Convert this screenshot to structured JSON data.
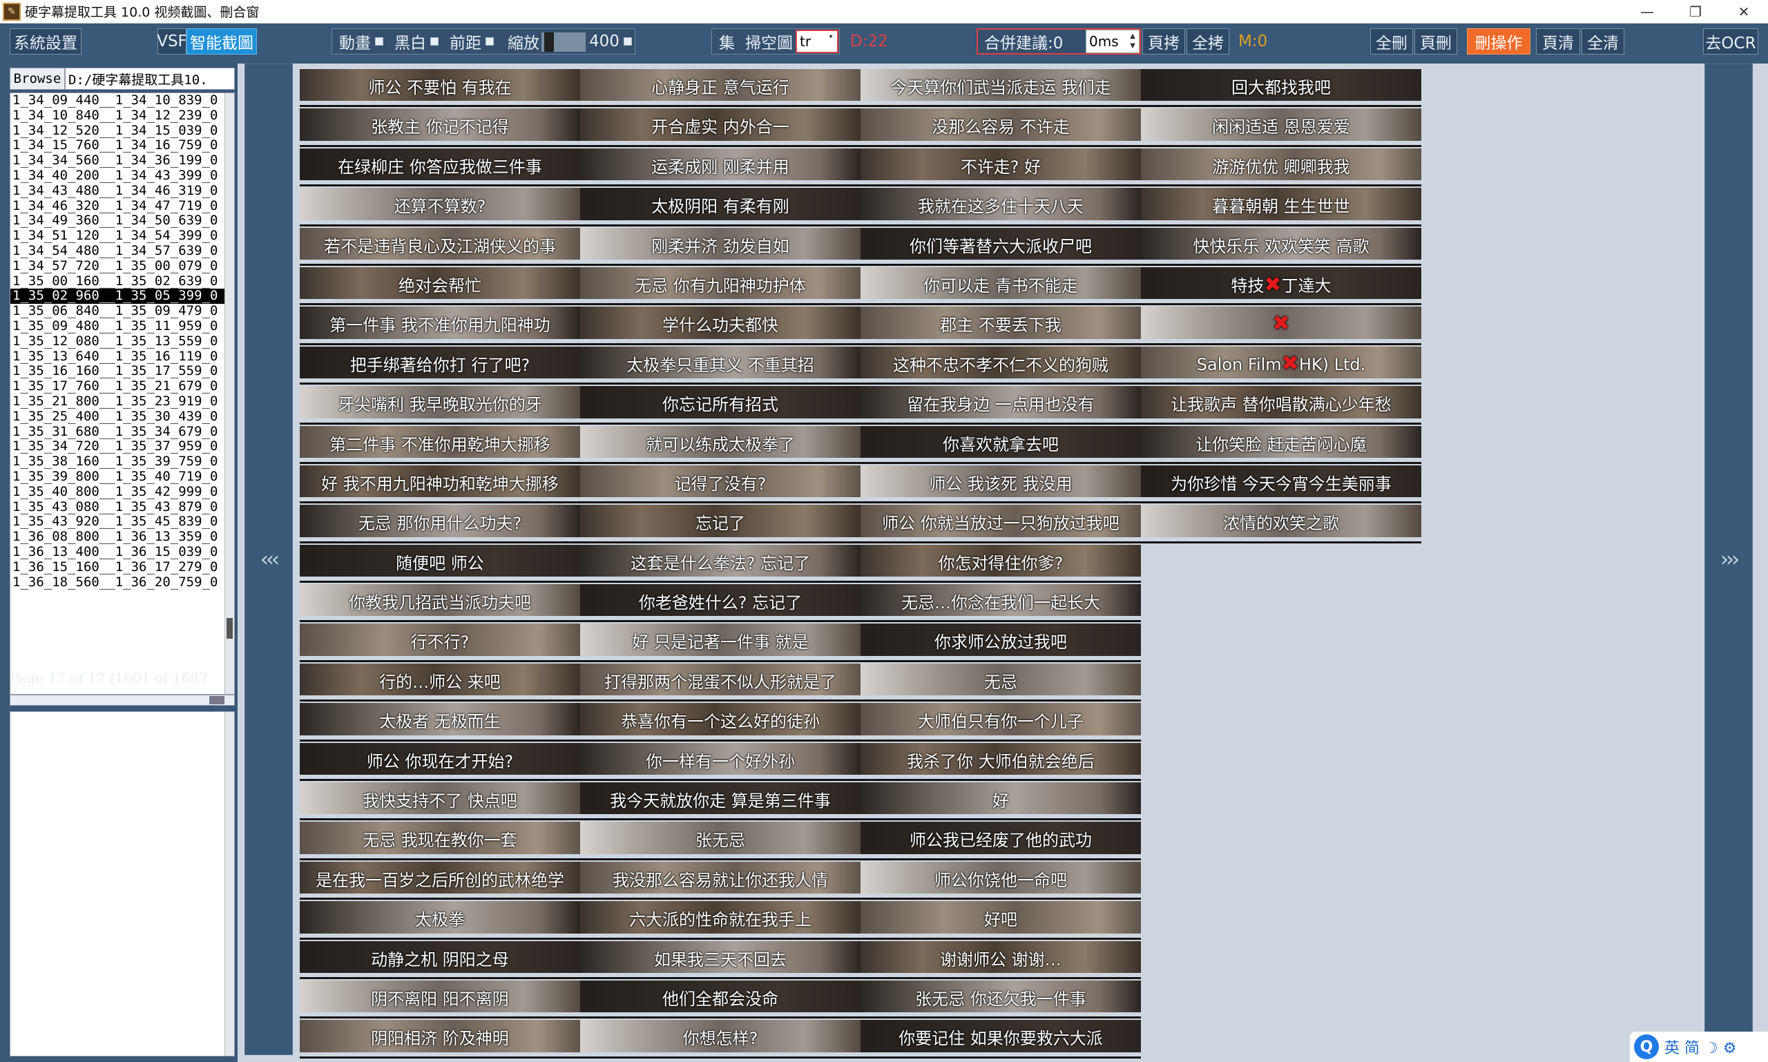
{
  "window": {
    "title": "硬字幕提取工具 10.0  视频截圖、刪合窗",
    "icon": "app-icon",
    "controls": [
      "—",
      "❐",
      "✕"
    ]
  },
  "toolbar": {
    "system_settings": "系統設置",
    "vsf": "VSF",
    "smart_capture": "智能截圖",
    "dynamic": "動畫",
    "bw": "黑白",
    "pre_dist": "前距",
    "zoom": "縮放",
    "zoom_value": "400",
    "collect": "集",
    "scan_empty": "掃空圖",
    "tr_value": "tr",
    "d_count": "D:22",
    "merge_suggest": "合併建議:0",
    "ms_value": "0ms",
    "page_select": "頁拷",
    "select_all": "全拷",
    "m_count": "M:0",
    "delete_all": "全刪",
    "page_delete": "頁刪",
    "delete_op": "刪操作",
    "page_clear": "頁清",
    "clear_all": "全清",
    "go_ocr": "去OCR",
    "accent_red": "#e04040",
    "accent_orange": "#e0a020"
  },
  "left_panel": {
    "browse_label": "Browse",
    "path": "D:/硬字幕提取工具10.",
    "files": [
      "1_34_09_440__1_34_10_839_0",
      "1_34_10_840__1_34_12_239_0",
      "1_34_12_520__1_34_15_039_0",
      "1_34_15_760__1_34_16_759_0",
      "1_34_34_560__1_34_36_199_0",
      "1_34_40_200__1_34_43_399_0",
      "1_34_43_480__1_34_46_319_0",
      "1_34_46_320__1_34_47_719_0",
      "1_34_49_360__1_34_50_639_0",
      "1_34_51_120__1_34_54_399_0",
      "1_34_54_480__1_34_57_639_0",
      "1_34_57_720__1_35_00_079_0",
      "1_35_00_160__1_35_02_639_0",
      "1_35_02_960__1_35_05_399_0",
      "1_35_06_840__1_35_09_479_0",
      "1_35_09_480__1_35_11_959_0",
      "1_35_12_080__1_35_13_559_0",
      "1_35_13_640__1_35_16_119_0",
      "1_35_16_160__1_35_17_559_0",
      "1_35_17_760__1_35_21_679_0",
      "1_35_21_800__1_35_23_919_0",
      "1_35_25_400__1_35_30_439_0",
      "1_35_31_680__1_35_34_679_0",
      "1_35_34_720__1_35_37_959_0",
      "1_35_38_160__1_35_39_759_0",
      "1_35_39_800__1_35_40_719_0",
      "1_35_40_800__1_35_42_999_0",
      "1_35_43_080__1_35_43_879_0",
      "1_35_43_920__1_35_45_839_0",
      "1_36_08_800__1_36_13_359_0",
      "1_36_13_400__1_36_15_039_0",
      "1_36_15_160__1_36_17_279_0",
      "1_36_18_560__1_36_20_759_0"
    ],
    "selected_index": 13,
    "page_info": "Page 17 of 17 (1601 of 1687"
  },
  "nav": {
    "prev": "‹‹‹",
    "next": "›››"
  },
  "columns": [
    [
      "师公 不要怕 有我在",
      "张教主 你记不记得",
      "在绿柳庄 你答应我做三件事",
      "还算不算数?",
      "若不是违背良心及江湖侠义的事",
      "绝对会帮忙",
      "第一件事 我不准你用九阳神功",
      "把手绑著给你打 行了吧?",
      "牙尖嘴利 我早晚取光你的牙",
      "第二件事 不准你用乾坤大挪移",
      "好 我不用九阳神功和乾坤大挪移",
      "无忌 那你用什么功夫?",
      "随便吧 师公",
      "你教我几招武当派功夫吧",
      "行不行?",
      "行的…师公 来吧",
      "太极者 无极而生",
      "师公 你现在才开始?",
      "我快支持不了 快点吧",
      "无忌 我现在教你一套",
      "是在我一百岁之后所创的武林绝学",
      "太极拳",
      "动静之机 阴阳之母",
      "阴不离阳 阳不离阴",
      "阴阳相济 阶及神明"
    ],
    [
      "心静身正 意气运行",
      "开合虚实 内外合一",
      "运柔成刚 刚柔并用",
      "太极阴阳 有柔有刚",
      "刚柔并济 劲发自如",
      "无忌 你有九阳神功护体",
      "学什么功夫都快",
      "太极拳只重其义 不重其招",
      "你忘记所有招式",
      "就可以练成太极拳了",
      "记得了没有?",
      "忘记了",
      "这套是什么拳法? 忘记了",
      "你老爸姓什么? 忘记了",
      "好 只是记著一件事 就是",
      "打得那两个混蛋不似人形就是了",
      "恭喜你有一个这么好的徒孙",
      "你一样有一个好外孙",
      "我今天就放你走 算是第三件事",
      "张无忌",
      "我没那么容易就让你还我人情",
      "六大派的性命就在我手上",
      "如果我三天不回去",
      "他们全都会没命",
      "你想怎样?"
    ],
    [
      "今天算你们武当派走运 我们走",
      "没那么容易 不许走",
      "不许走? 好",
      "我就在这多住十天八天",
      "你们等著替六大派收尸吧",
      "你可以走 青书不能走",
      "郡主 不要丢下我",
      "这种不忠不孝不仁不义的狗贼",
      "留在我身边 一点用也没有",
      "你喜欢就拿去吧",
      "师公 我该死 我没用",
      "师公 你就当放过一只狗放过我吧",
      "你怎对得住你爹?",
      "无忌…你念在我们一起长大",
      "你求师公放过我吧",
      "无忌",
      "大师伯只有你一个儿子",
      "我杀了你 大师伯就会绝后",
      "好",
      "师公我已经废了他的武功",
      "师公你饶他一命吧",
      "好吧",
      "谢谢师公 谢谢…",
      "张无忌 你还欠我一件事",
      "你要记住 如果你要救六大派"
    ],
    [
      "回大都找我吧",
      "闲闲适适 恩恩爱爱",
      "游游优优 卿卿我我",
      "暮暮朝朝 生生世世",
      "快快乐乐 欢欢笑笑 高歌",
      "特技✖丁達大",
      "✖",
      "Salon Film✖HK) Ltd.",
      "让我歌声 替你唱散满心少年愁",
      "让你笑脸 赶走苦闷心魔",
      "为你珍惜 今天今宵今生美丽事",
      "浓情的欢笑之歌"
    ]
  ],
  "ime": {
    "label": "英 简 ☽ ⚙"
  }
}
